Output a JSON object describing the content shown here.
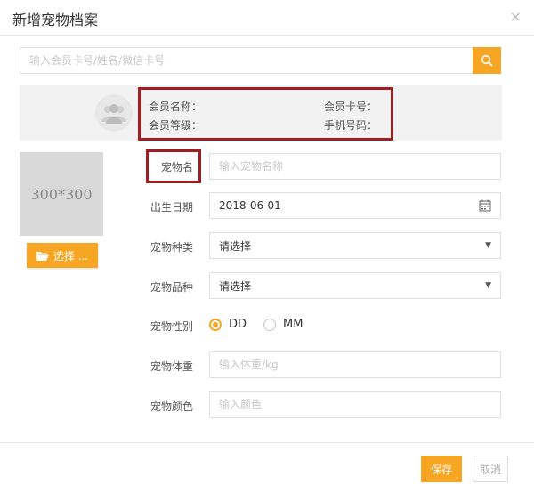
{
  "dialog": {
    "title": "新增宠物档案",
    "close_glyph": "×"
  },
  "search": {
    "placeholder": "输入会员卡号/姓名/微信卡号",
    "icon": "search-icon"
  },
  "member": {
    "avatar_icon": "user-group-icon",
    "name_label": "会员名称：",
    "level_label": "会员等级：",
    "card_label": "会员卡号：",
    "phone_label": "手机号码："
  },
  "photo": {
    "placeholder_text": "300*300",
    "choose_label": "选择 ...",
    "choose_icon": "folder-open-icon"
  },
  "form": {
    "name": {
      "label": "宠物名",
      "placeholder": "输入宠物名称"
    },
    "birth": {
      "label": "出生日期",
      "value": "2018-06-01",
      "icon": "calendar-icon"
    },
    "species": {
      "label": "宠物种类",
      "value": "请选择"
    },
    "breed": {
      "label": "宠物品种",
      "value": "请选择"
    },
    "gender": {
      "label": "宠物性别",
      "options": [
        "DD",
        "MM"
      ],
      "selected": "DD"
    },
    "weight": {
      "label": "宠物体重",
      "placeholder": "输入体重/kg"
    },
    "color": {
      "label": "宠物颜色",
      "placeholder": "输入颜色"
    }
  },
  "footer": {
    "save_label": "保存",
    "cancel_label": "取消"
  },
  "colors": {
    "accent": "#f6a623",
    "highlight": "#a01e22"
  }
}
